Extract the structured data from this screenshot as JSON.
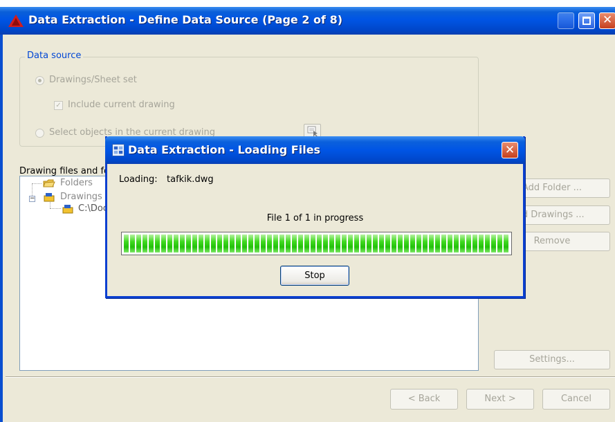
{
  "main_window": {
    "title": "Data Extraction - Define Data Source (Page 2 of 8)",
    "data_source": {
      "legend": "Data source",
      "option_drawings": "Drawings/Sheet set",
      "include_current": "Include current drawing",
      "option_select_objects": "Select objects in the current drawing"
    },
    "files_label": "Drawing files and fo",
    "tree": {
      "folders": "Folders",
      "drawings": "Drawings",
      "path": "C:\\Doc"
    },
    "side_buttons": {
      "add_folder": "Add Folder ...",
      "add_drawings": "ld Drawings ...",
      "remove": "Remove",
      "settings": "Settings..."
    },
    "nav": {
      "back": "< Back",
      "next": "Next >",
      "cancel": "Cancel"
    }
  },
  "loading_dialog": {
    "title": "Data Extraction - Loading Files",
    "loading_label": "Loading:",
    "loading_file": "tafkik.dwg",
    "progress_text": "File 1 of 1 in progress",
    "progress_fraction": 1.0,
    "stop_label": "Stop"
  },
  "icons": {
    "app": "autocad-icon",
    "dialog": "data-extraction-icon",
    "close": "close-icon",
    "maximize": "maximize-icon",
    "minimize": "minimize-icon",
    "pick": "select-objects-icon",
    "folder": "folder-icon",
    "drawing": "drawing-file-icon"
  },
  "colors": {
    "title_bar": "#0055e5",
    "progress": "#22c10a",
    "legend": "#0046d5"
  }
}
